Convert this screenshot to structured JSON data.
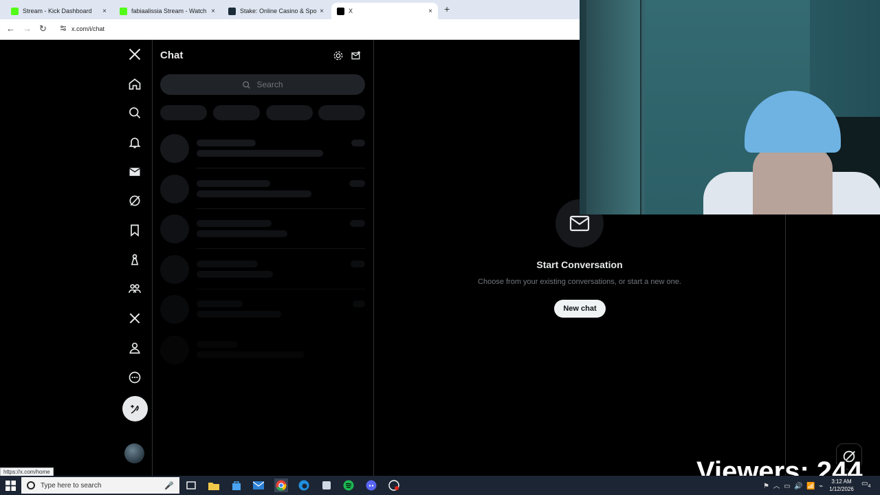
{
  "browser": {
    "tabs": [
      {
        "title": "Stream - Kick Dashboard",
        "favicon_color": "#53fc18",
        "favicon_glyph": "K"
      },
      {
        "title": "fabiaalissia Stream - Watch Live",
        "favicon_color": "#53fc18",
        "favicon_glyph": "K"
      },
      {
        "title": "Stake: Online Casino & Sports B",
        "favicon_color": "#1a2c38",
        "favicon_glyph": "S"
      },
      {
        "title": "X",
        "favicon_color": "#000000",
        "favicon_glyph": "X"
      }
    ],
    "new_tab": "+",
    "tab_close": "×",
    "url": "x.com/i/chat",
    "status_link": "https://x.com/home"
  },
  "x_app": {
    "nav": [
      "x-logo-icon",
      "home-icon",
      "explore-icon",
      "notifications-icon",
      "messages-icon",
      "grok-icon",
      "bookmarks-icon",
      "jobs-icon",
      "communities-icon",
      "premium-icon",
      "profile-icon",
      "more-icon"
    ],
    "chat_title": "Chat",
    "search_placeholder": "Search",
    "empty_state": {
      "title": "Start Conversation",
      "subtitle": "Choose from your existing conversations, or start a new one.",
      "button": "New chat"
    },
    "accent": "#eff3f4"
  },
  "overlay": {
    "viewers_text": "Viewers: 244"
  },
  "taskbar": {
    "search_placeholder": "Type here to search",
    "clock_time": "3:12 AM",
    "clock_date": "1/12/2026",
    "notification_count": "4"
  }
}
